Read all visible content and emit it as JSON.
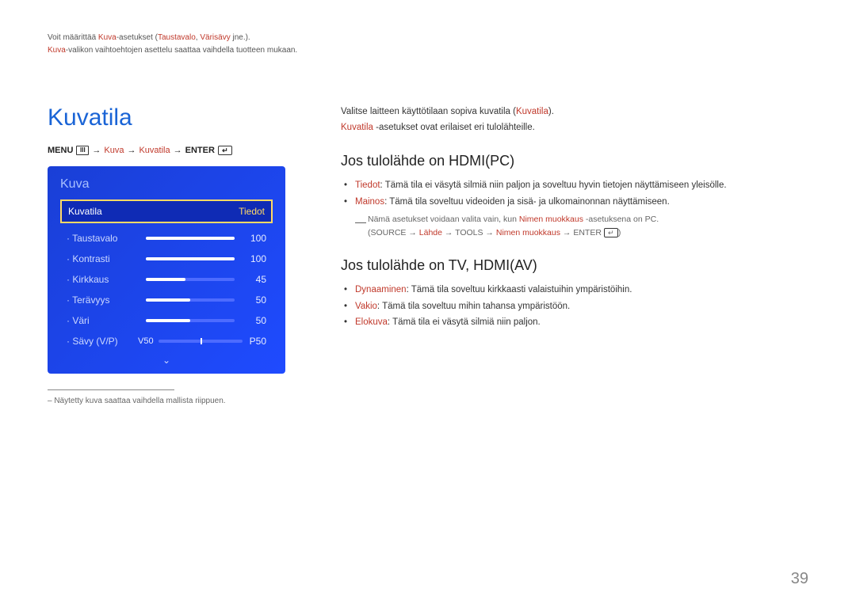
{
  "chapter": {
    "intro_plain_1": "Voit määrittää ",
    "intro_k1": "Kuva",
    "intro_plain_2": "-asetukset (",
    "intro_k2": "Taustavalo",
    "intro_plain_3": ", ",
    "intro_k3": "Värisävy",
    "intro_plain_4": " jne.).",
    "intro_line2_k": "Kuva",
    "intro_line2_rest": "-valikon vaihtoehtojen asettelu saattaa vaihdella tuotteen mukaan."
  },
  "section_title": "Kuvatila",
  "menu_path": {
    "menu_label": "MENU",
    "step1": "Kuva",
    "step2": "Kuvatila",
    "enter_label": "ENTER"
  },
  "panel": {
    "title": "Kuva",
    "selected_label": "Kuvatila",
    "selected_value": "Tiedot",
    "rows": [
      {
        "label": "· Taustavalo",
        "value": "100",
        "fill": 100
      },
      {
        "label": "· Kontrasti",
        "value": "100",
        "fill": 100
      },
      {
        "label": "· Kirkkaus",
        "value": "45",
        "fill": 45
      },
      {
        "label": "· Terävyys",
        "value": "50",
        "fill": 50
      },
      {
        "label": "· Väri",
        "value": "50",
        "fill": 50
      }
    ],
    "savy": {
      "label": "· Sävy (V/P)",
      "left": "V50",
      "right": "P50"
    }
  },
  "footnote": "– Näytetty kuva saattaa vaihdella mallista riippuen.",
  "right": {
    "lead1_a": "Valitse laitteen käyttötilaan sopiva kuvatila (",
    "lead1_k": "Kuvatila",
    "lead1_b": ").",
    "lead2_k": "Kuvatila",
    "lead2_rest": " -asetukset ovat erilaiset eri tulolähteille.",
    "h2a": "Jos tulolähde on HDMI(PC)",
    "pc_items": [
      {
        "k": "Tiedot",
        "t": ": Tämä tila ei väsytä silmiä niin paljon ja soveltuu hyvin tietojen näyttämiseen yleisölle."
      },
      {
        "k": "Mainos",
        "t": ": Tämä tila soveltuu videoiden ja sisä- ja ulkomainonnan näyttämiseen."
      }
    ],
    "note_a": "Nämä asetukset voidaan valita vain, kun ",
    "note_k1": "Nimen muokkaus",
    "note_b": " -asetuksena on PC.",
    "note2_open": "(SOURCE → ",
    "note2_k1": "Lähde",
    "note2_mid": " → TOOLS → ",
    "note2_k2": "Nimen muokkaus",
    "note2_end": " → ENTER ",
    "note2_close": ")",
    "h2b": "Jos tulolähde on TV, HDMI(AV)",
    "av_items": [
      {
        "k": "Dynaaminen",
        "t": ": Tämä tila soveltuu kirkkaasti valaistuihin ympäristöihin."
      },
      {
        "k": "Vakio",
        "t": ": Tämä tila soveltuu mihin tahansa ympäristöön."
      },
      {
        "k": "Elokuva",
        "t": ": Tämä tila ei väsytä silmiä niin paljon."
      }
    ]
  },
  "page_number": "39"
}
